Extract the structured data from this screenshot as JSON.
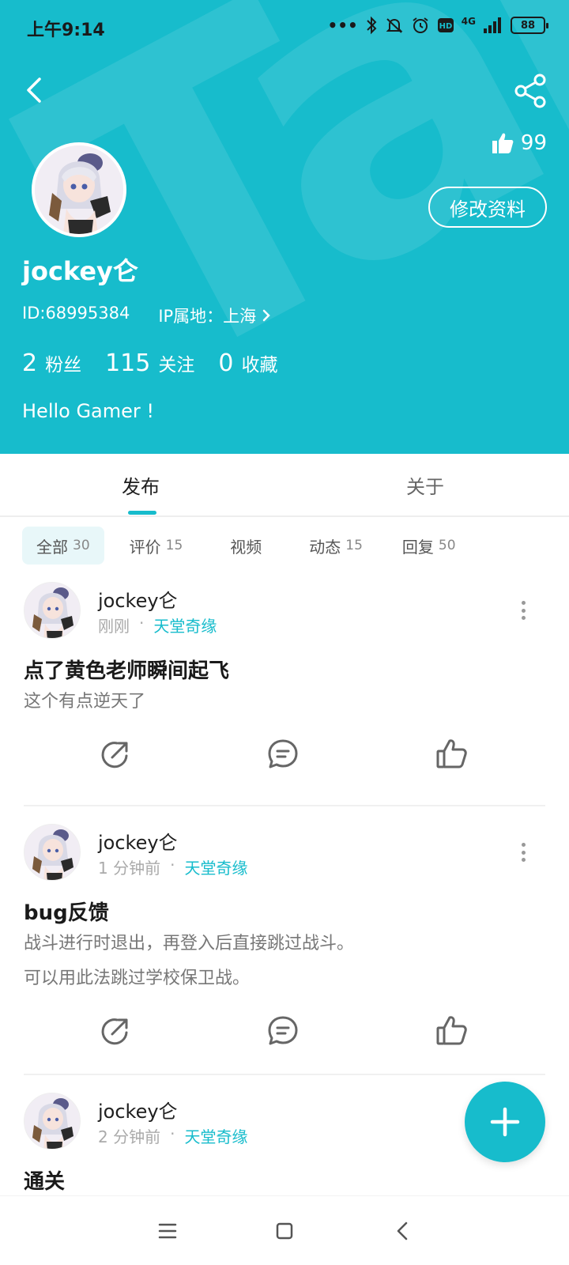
{
  "colors": {
    "accent": "#17bccc",
    "header_bg": "#17bccc",
    "text_dark": "#1f1f1f",
    "text_muted": "#aaaaaa"
  },
  "status_bar": {
    "time": "上午9:14",
    "network": "4G",
    "battery": "88"
  },
  "header": {
    "watermark": "TapTap",
    "likes": "99",
    "edit_label": "修改资料",
    "username": "jockey仑",
    "id_text": "ID:68995384",
    "ip_text": "IP属地：上海",
    "stats": [
      {
        "num": "2",
        "label": "粉丝"
      },
      {
        "num": "115",
        "label": "关注"
      },
      {
        "num": "0",
        "label": "收藏"
      }
    ],
    "bio": "Hello Gamer !"
  },
  "tabs": [
    {
      "label": "发布"
    },
    {
      "label": "关于"
    }
  ],
  "filters": [
    {
      "label": "全部",
      "count": "30"
    },
    {
      "label": "评价",
      "count": "15"
    },
    {
      "label": "视频",
      "count": ""
    },
    {
      "label": "动态",
      "count": "15"
    },
    {
      "label": "回复",
      "count": "50"
    }
  ],
  "posts": [
    {
      "author": "jockey仑",
      "time": "刚刚",
      "game": "天堂奇缘",
      "title": "点了黄色老师瞬间起飞",
      "body": [
        "这个有点逆天了"
      ]
    },
    {
      "author": "jockey仑",
      "time": "1 分钟前",
      "game": "天堂奇缘",
      "title": "bug反馈",
      "body": [
        "战斗进行时退出，再登入后直接跳过战斗。",
        "可以用此法跳过学校保卫战。"
      ]
    },
    {
      "author": "jockey仑",
      "time": "2 分钟前",
      "game": "天堂奇缘",
      "title": "通关",
      "body": []
    }
  ],
  "meta_separator": "·",
  "icons": {
    "back": "chevron-left-icon",
    "share": "share-icon",
    "like": "thumbs-up-icon",
    "repost": "repost-icon",
    "comment": "comment-icon",
    "more": "more-vertical-icon",
    "add": "plus-icon",
    "menu": "menu-icon",
    "home": "square-icon",
    "nav_back": "nav-back-icon"
  }
}
